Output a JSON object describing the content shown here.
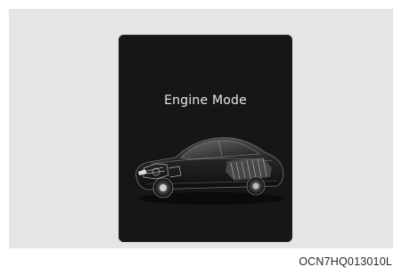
{
  "screen": {
    "title": "Engine Mode"
  },
  "figure": {
    "code": "OCN7HQ013010L"
  },
  "colors": {
    "screen_background": "#161616",
    "figure_background": "#e5e5e5",
    "title_text": "#e8e8e8"
  },
  "icons": {
    "vehicle": "car-xray-illustration-icon"
  }
}
